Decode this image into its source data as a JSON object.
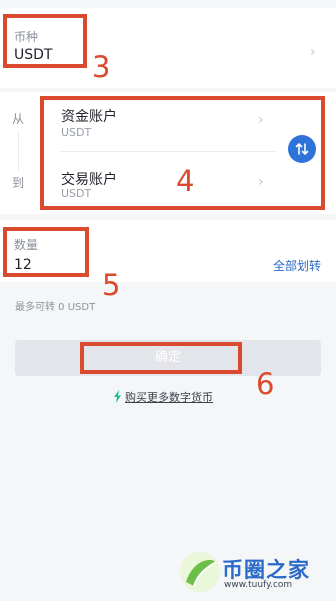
{
  "currency": {
    "label": "币种",
    "value": "USDT"
  },
  "transfer": {
    "from_label": "从",
    "to_label": "到",
    "from_account": {
      "name": "资金账户",
      "currency": "USDT"
    },
    "to_account": {
      "name": "交易账户",
      "currency": "USDT"
    }
  },
  "amount": {
    "label": "数量",
    "value": "12",
    "all_transfer": "全部划转",
    "max_hint": "最多可转 0 USDT"
  },
  "confirm_label": "确定",
  "buy_link": "购买更多数字货币",
  "annotations": [
    "3",
    "4",
    "5",
    "6"
  ],
  "watermark": {
    "brand": "币圈之家",
    "url": "www.tuufy.com"
  },
  "colors": {
    "accent": "#2e73d9",
    "annotation": "#d94a2e",
    "bolt": "#1fbf8f"
  },
  "icons": {
    "chevron": "chevron-right-icon",
    "swap": "swap-icon",
    "bolt": "lightning-icon"
  }
}
